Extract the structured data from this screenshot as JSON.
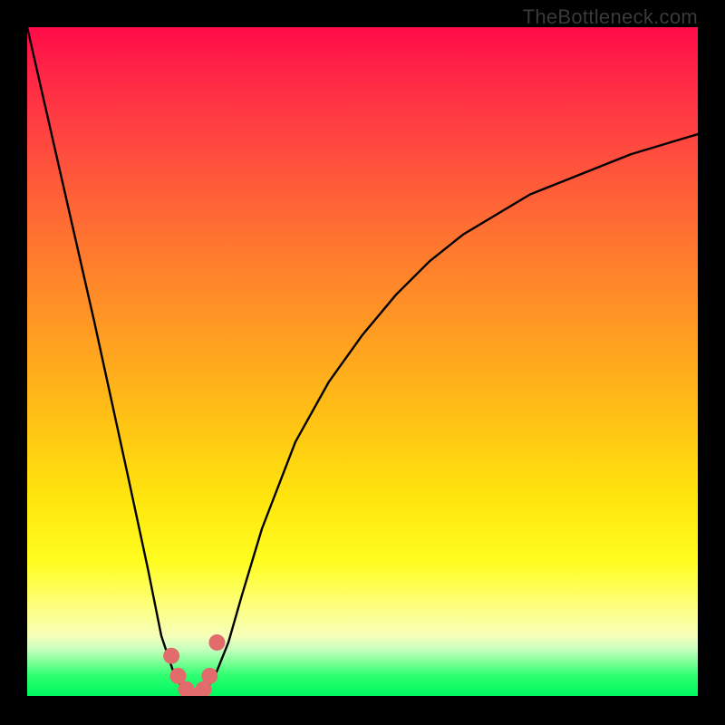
{
  "watermark": "TheBottleneck.com",
  "chart_data": {
    "type": "line",
    "title": "",
    "xlabel": "",
    "ylabel": "",
    "xlim": [
      0,
      100
    ],
    "ylim": [
      0,
      100
    ],
    "series": [
      {
        "name": "bottleneck-curve",
        "x": [
          0,
          5,
          10,
          15,
          18,
          20,
          22,
          24,
          26,
          28,
          30,
          32,
          35,
          40,
          45,
          50,
          55,
          60,
          65,
          70,
          75,
          80,
          85,
          90,
          95,
          100
        ],
        "y": [
          100,
          78,
          56,
          33,
          19,
          9,
          3,
          0,
          0,
          3,
          8,
          15,
          25,
          38,
          47,
          54,
          60,
          65,
          69,
          72,
          75,
          77,
          79,
          81,
          82.5,
          84
        ]
      }
    ],
    "markers": {
      "name": "highlighted-points",
      "color": "#e26b6b",
      "x": [
        21.5,
        22.5,
        23.7,
        25.0,
        26.3,
        27.2,
        28.3
      ],
      "y": [
        6,
        3,
        1,
        0,
        1,
        3,
        8
      ]
    }
  }
}
